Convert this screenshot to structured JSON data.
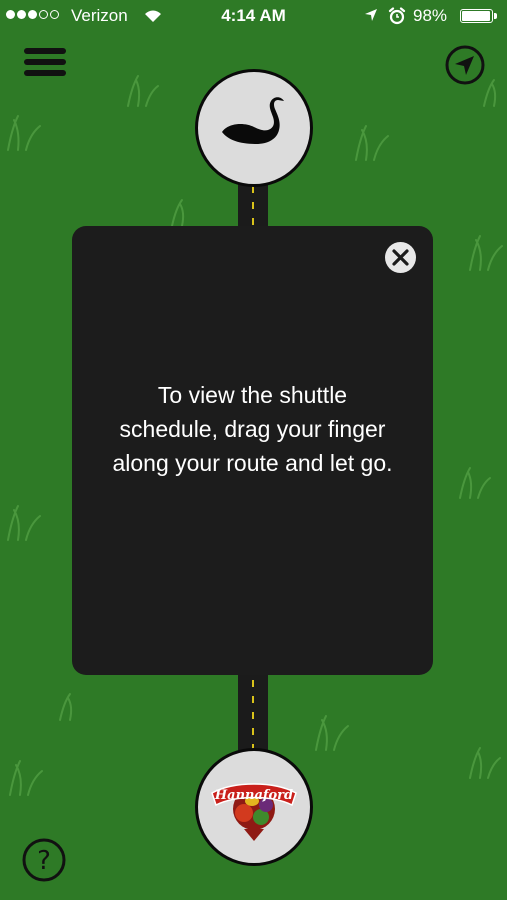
{
  "status_bar": {
    "carrier": "Verizon",
    "signal_bars_filled": 3,
    "signal_bars_total": 5,
    "time": "4:14 AM",
    "battery_percent": "98%",
    "battery_level": 0.98,
    "icons": [
      "wifi-icon",
      "location-arrow-icon",
      "alarm-clock-icon",
      "battery-icon"
    ]
  },
  "toolbar": {
    "menu_icon": "hamburger-menu-icon",
    "locate_icon": "location-arrow-icon"
  },
  "route": {
    "start_stop_icon": "swan-icon",
    "end_stop_logo": "Hannaford"
  },
  "modal": {
    "message": "To view the shuttle schedule, drag your finger along your route and let go.",
    "close_icon": "close-circle-icon"
  },
  "help": {
    "icon": "question-mark-icon",
    "label": "?"
  },
  "colors": {
    "background_green": "#2e7a26",
    "modal_background": "#1c1c1c",
    "road": "#1b1b1b",
    "road_line": "#d9c21b",
    "stop_fill": "#dcdcdc"
  }
}
